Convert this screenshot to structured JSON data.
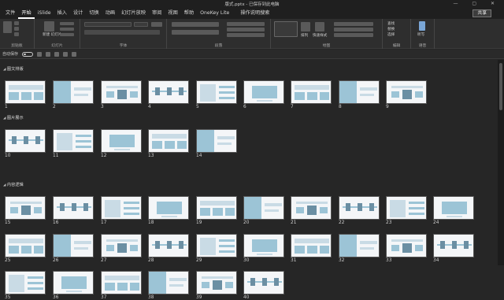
{
  "window": {
    "title": "版式.pptx - 已保存到此电脑",
    "controls": "— ▢ ✕"
  },
  "tabs": [
    "文件",
    "开始",
    "iSlide",
    "插入",
    "设计",
    "切换",
    "动画",
    "幻灯片放映",
    "审阅",
    "视图",
    "帮助",
    "OneKey Lite",
    "操作说明搜索"
  ],
  "active_tab": "开始",
  "share_label": "共享",
  "ribbon": {
    "groups": [
      "剪贴板",
      "幻灯片",
      "字体",
      "段落",
      "绘图",
      "编辑",
      "语音"
    ],
    "labels": {
      "new_slide": "新建\n幻灯片",
      "arrange": "排列",
      "quick_styles": "快速样式",
      "find": "查找",
      "replace": "替换",
      "select": "选择",
      "dictate": "听写"
    }
  },
  "qat": {
    "autosave_label": "自动保存",
    "autosave_state": "关"
  },
  "sections": [
    {
      "name": "图文排版",
      "slides": [
        1,
        2,
        3,
        4,
        5,
        6,
        7,
        8,
        9
      ]
    },
    {
      "name": "图片展示",
      "slides": [
        10,
        11,
        12,
        13,
        14
      ]
    },
    {
      "name": "内容逻辑",
      "slides": [
        15,
        16,
        17,
        18,
        19,
        20,
        21,
        22,
        23,
        24,
        25,
        26,
        27,
        28,
        29,
        30,
        31,
        32,
        33,
        34,
        35,
        36,
        37,
        38,
        39,
        40
      ]
    }
  ],
  "colors": {
    "accent": "#9cc4d6",
    "accent_dark": "#6b8fa3",
    "background": "#262626"
  }
}
